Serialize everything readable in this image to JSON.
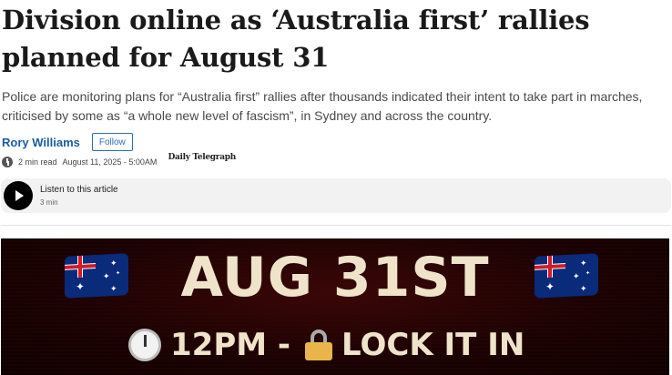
{
  "article": {
    "headline": "Division online as ‘Australia first’ rallies planned for August 31",
    "standfirst": "Police are monitoring plans for “Australia first” rallies after thousands indicated their intent to take part in marches, criticised by some as “a whole new level of fascism”, in Sydney and across the country.",
    "author": "Rory Williams",
    "follow_label": "Follow",
    "read_time": "2 min read",
    "date": "August 11, 2025 - 5:00AM",
    "publisher": "Daily Telegraph"
  },
  "listen": {
    "title": "Listen to this article",
    "duration": "3 min"
  },
  "hero": {
    "line1": "AUG 31ST",
    "line2_time": "12PM -",
    "line2_text": "LOCK IT IN",
    "icons": [
      "australia-flag-icon",
      "clock-icon",
      "lock-icon"
    ],
    "colors": {
      "text": "#efe3c9",
      "background": "#2a0404"
    }
  },
  "colors": {
    "author_link": "#1a5ca0",
    "follow_button": "#2a6fb5"
  }
}
